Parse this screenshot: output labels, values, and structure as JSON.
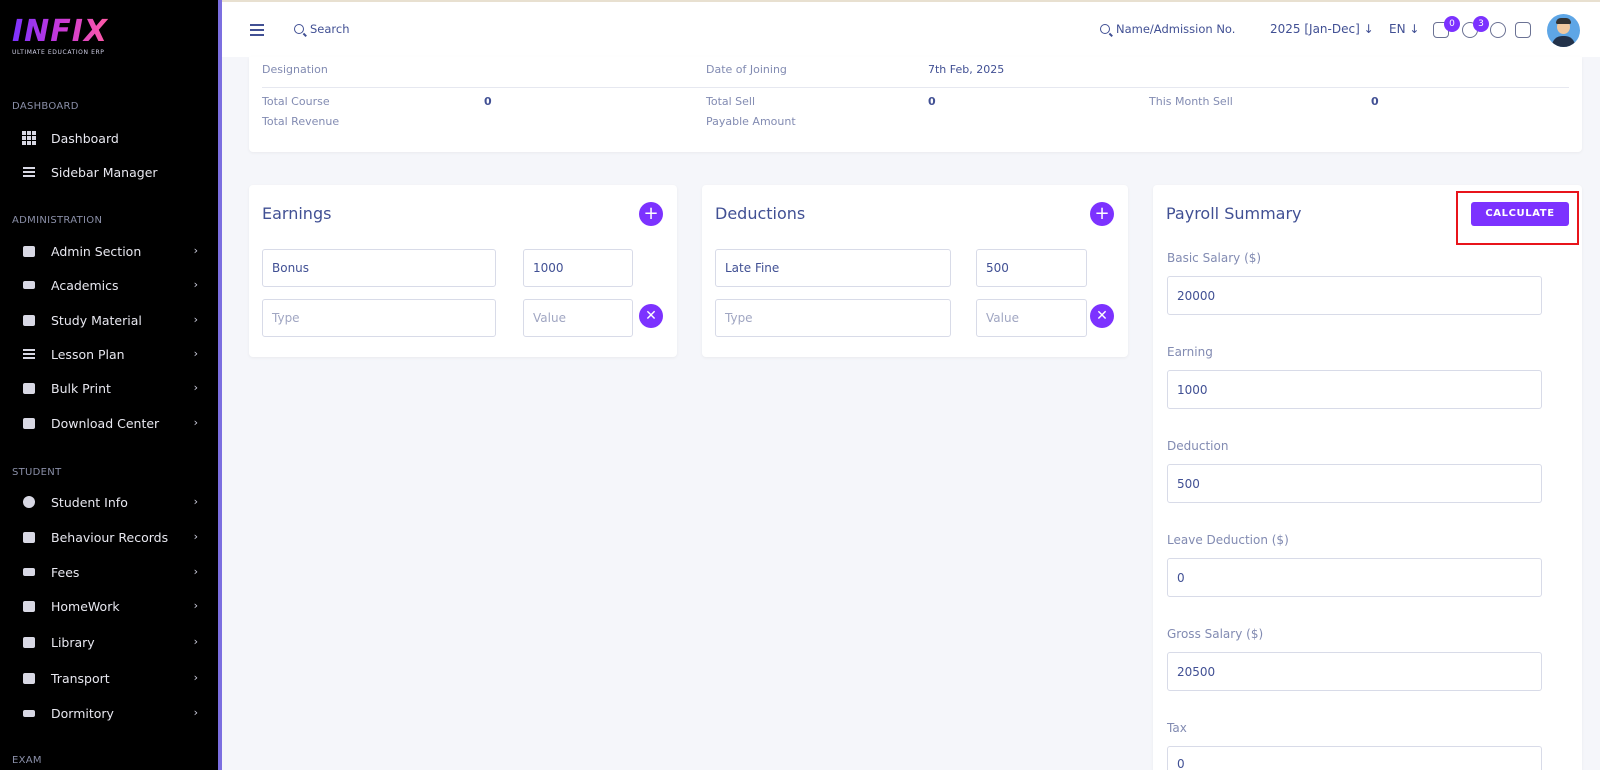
{
  "app": {
    "logo_text": "INFIX",
    "logo_subtitle": "ULTIMATE EDUCATION ERP"
  },
  "sidebar": {
    "sections": [
      {
        "title": "DASHBOARD",
        "items": [
          {
            "label": "Dashboard",
            "icon": "grid-icon",
            "chevron": false
          },
          {
            "label": "Sidebar Manager",
            "icon": "menu-icon",
            "chevron": false
          }
        ]
      },
      {
        "title": "ADMINISTRATION",
        "items": [
          {
            "label": "Admin Section",
            "icon": "admin-icon",
            "chevron": true
          },
          {
            "label": "Academics",
            "icon": "graduation-cap-icon",
            "chevron": true
          },
          {
            "label": "Study Material",
            "icon": "download-icon",
            "chevron": true
          },
          {
            "label": "Lesson Plan",
            "icon": "list-icon",
            "chevron": true
          },
          {
            "label": "Bulk Print",
            "icon": "printer-icon",
            "chevron": true
          },
          {
            "label": "Download Center",
            "icon": "download-icon",
            "chevron": true
          }
        ]
      },
      {
        "title": "STUDENT",
        "items": [
          {
            "label": "Student Info",
            "icon": "user-icon",
            "chevron": true
          },
          {
            "label": "Behaviour Records",
            "icon": "records-icon",
            "chevron": true
          },
          {
            "label": "Fees",
            "icon": "money-icon",
            "chevron": true
          },
          {
            "label": "HomeWork",
            "icon": "book-icon",
            "chevron": true
          },
          {
            "label": "Library",
            "icon": "library-icon",
            "chevron": true
          },
          {
            "label": "Transport",
            "icon": "bus-icon",
            "chevron": true
          },
          {
            "label": "Dormitory",
            "icon": "bed-icon",
            "chevron": true
          }
        ]
      },
      {
        "title": "EXAM",
        "items": []
      }
    ]
  },
  "header": {
    "search_label": "Search",
    "admission_search_label": "Name/Admission No.",
    "year_label": "2025 [Jan-Dec]",
    "lang_label": "EN",
    "messages_badge": "0",
    "notifications_badge": "3"
  },
  "info": {
    "designation_label": "Designation",
    "designation_value": "",
    "joining_label": "Date of Joining",
    "joining_value": "7th Feb, 2025",
    "total_course_label": "Total Course",
    "total_course_value": "0",
    "total_sell_label": "Total Sell",
    "total_sell_value": "0",
    "month_sell_label": "This Month Sell",
    "month_sell_value": "0",
    "total_revenue_label": "Total Revenue",
    "total_revenue_value": "",
    "payable_label": "Payable Amount",
    "payable_value": ""
  },
  "earnings": {
    "title": "Earnings",
    "rows": [
      {
        "type": "Bonus",
        "value": "1000"
      }
    ],
    "type_placeholder": "Type",
    "value_placeholder": "Value"
  },
  "deductions": {
    "title": "Deductions",
    "rows": [
      {
        "type": "Late Fine",
        "value": "500"
      }
    ],
    "type_placeholder": "Type",
    "value_placeholder": "Value"
  },
  "summary": {
    "title": "Payroll Summary",
    "calculate_label": "CALCULATE",
    "fields": [
      {
        "label": "Basic Salary ($)",
        "value": "20000"
      },
      {
        "label": "Earning",
        "value": "1000"
      },
      {
        "label": "Deduction",
        "value": "500"
      },
      {
        "label": "Leave Deduction ($)",
        "value": "0"
      },
      {
        "label": "Gross Salary ($)",
        "value": "20500"
      },
      {
        "label": "Tax",
        "value": "0"
      }
    ]
  }
}
